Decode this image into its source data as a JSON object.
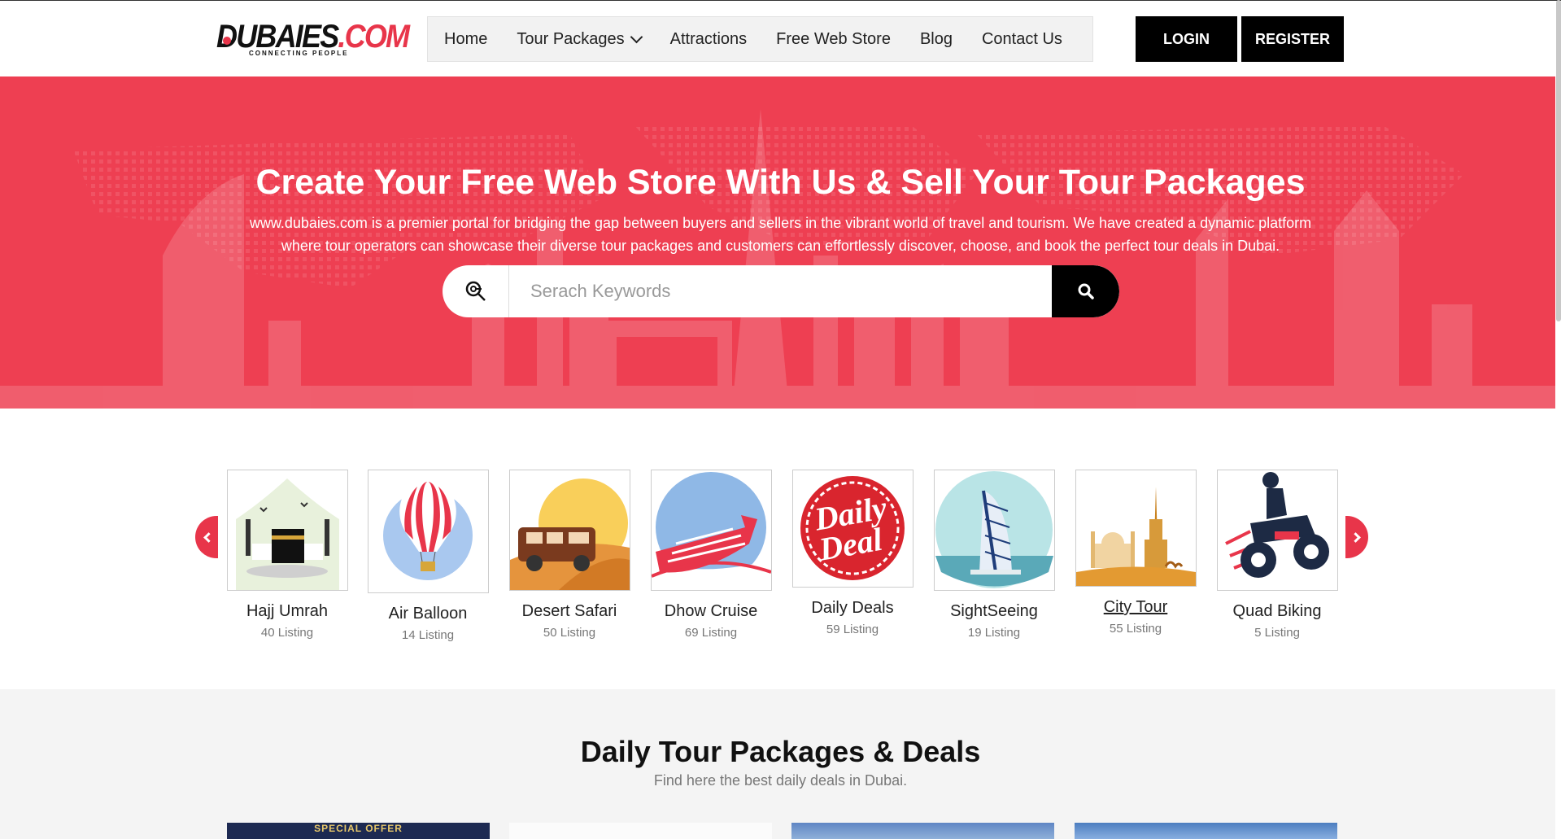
{
  "header": {
    "logo_main_black": "DUBAIES",
    "logo_main_red": ".COM",
    "logo_tagline": "CONNECTING PEOPLE",
    "nav": [
      {
        "label": "Home"
      },
      {
        "label": "Tour Packages"
      },
      {
        "label": "Attractions"
      },
      {
        "label": "Free Web Store"
      },
      {
        "label": "Blog"
      },
      {
        "label": "Contact Us"
      }
    ],
    "login_label": "LOGIN",
    "register_label": "REGISTER"
  },
  "hero": {
    "title": "Create Your Free Web Store With Us & Sell Your Tour Packages",
    "description_line1": "www.dubaies.com is a premier portal for bridging the gap between buyers and sellers in the vibrant world of travel and tourism. We have created a dynamic platform",
    "description_line2": "where tour operators can showcase their diverse tour packages and customers can effortlessly discover, choose, and book the perfect tour deals in Dubai.",
    "search_placeholder": "Serach Keywords"
  },
  "categories": [
    {
      "name": "Hajj Umrah",
      "count": "40 Listing",
      "icon": "kaaba-icon"
    },
    {
      "name": "Air Balloon",
      "count": "14 Listing",
      "icon": "hot-air-balloon-icon"
    },
    {
      "name": "Desert Safari",
      "count": "50 Listing",
      "icon": "desert-jeep-icon"
    },
    {
      "name": "Dhow Cruise",
      "count": "69 Listing",
      "icon": "boat-icon"
    },
    {
      "name": "Daily Deals",
      "count": "59 Listing",
      "icon": "daily-deal-stamp-icon",
      "stamp_line1": "Daily",
      "stamp_line2": "Deal"
    },
    {
      "name": "SightSeeing",
      "count": "19 Listing",
      "icon": "burj-al-arab-icon"
    },
    {
      "name": "City Tour",
      "count": "55 Listing",
      "icon": "city-skyline-icon"
    },
    {
      "name": "Quad Biking",
      "count": "5 Listing",
      "icon": "quad-bike-icon"
    }
  ],
  "deals": {
    "title": "Daily Tour Packages & Deals",
    "subtitle": "Find here the best daily deals in Dubai.",
    "card1_banner": "SPECIAL OFFER"
  },
  "colors": {
    "brand_red": "#ee3f52",
    "accent_red": "#e8354a",
    "black": "#000000",
    "nav_bg": "#f2f2f2"
  }
}
